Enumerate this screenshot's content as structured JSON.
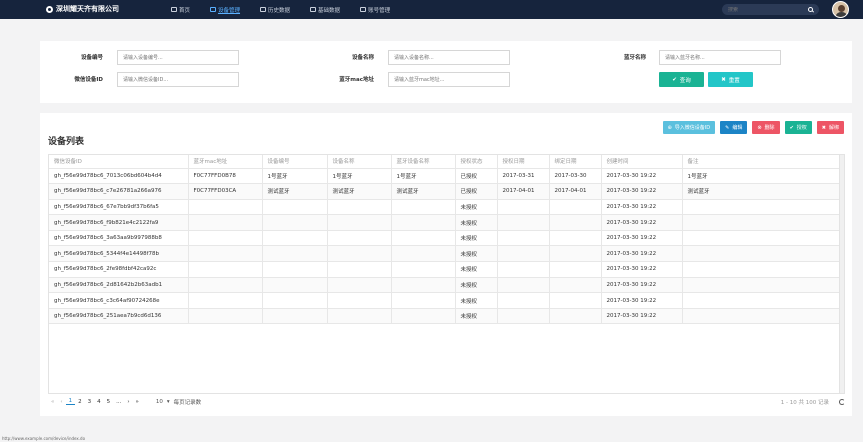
{
  "brand": "深圳耀天齐有限公司",
  "nav": [
    {
      "label": "首页",
      "icon": "home-icon"
    },
    {
      "label": "设备管理",
      "icon": "device-icon"
    },
    {
      "label": "历史数据",
      "icon": "history-icon"
    },
    {
      "label": "基础数据",
      "icon": "list-icon"
    },
    {
      "label": "账号管理",
      "icon": "account-icon"
    }
  ],
  "search": {
    "placeholder": "搜索"
  },
  "filter": {
    "device_no_label": "设备编号",
    "device_no_placeholder": "请输入设备编号...",
    "device_name_label": "设备名称",
    "device_name_placeholder": "请输入设备名称...",
    "bt_name_label": "蓝牙名称",
    "bt_name_placeholder": "请输入蓝牙名称...",
    "wx_device_label": "微信设备ID",
    "wx_device_placeholder": "请输入微信设备ID...",
    "bt_mac_label": "蓝牙mac地址",
    "bt_mac_placeholder": "请输入蓝牙mac地址...",
    "query_label": "查询",
    "reset_label": "重置"
  },
  "list": {
    "title": "设备列表",
    "tools": {
      "import_label": "导入微信设备ID",
      "edit_label": "编辑",
      "delete_label": "删除",
      "authorize_label": "授权",
      "unbind_label": "解绑"
    },
    "columns": [
      "微信设备ID",
      "蓝牙mac地址",
      "设备编号",
      "设备名称",
      "蓝牙设备名称",
      "授权状态",
      "授权日期",
      "绑定日期",
      "创建时间",
      "备注"
    ],
    "rows": [
      [
        "gh_f56e99d78bc6_7013c06bd604b4d4",
        "F0C77FFD0B78",
        "1号蓝牙",
        "1号蓝牙",
        "1号蓝牙",
        "已授权",
        "2017-03-31",
        "2017-03-30",
        "2017-03-30 19:22",
        "1号蓝牙"
      ],
      [
        "gh_f56e99d78bc6_c7e26781a266a976",
        "F0C77FFD03CA",
        "测试蓝牙",
        "测试蓝牙",
        "测试蓝牙",
        "已授权",
        "2017-04-01",
        "2017-04-01",
        "2017-03-30 19:22",
        "测试蓝牙"
      ],
      [
        "gh_f56e99d78bc6_67e7bb9df37b6fa5",
        "",
        "",
        "",
        "",
        "未授权",
        "",
        "",
        "2017-03-30 19:22",
        ""
      ],
      [
        "gh_f56e99d78bc6_f9b821e4c2122fa9",
        "",
        "",
        "",
        "",
        "未授权",
        "",
        "",
        "2017-03-30 19:22",
        ""
      ],
      [
        "gh_f56e99d78bc6_3a63aa9b997988b8",
        "",
        "",
        "",
        "",
        "未授权",
        "",
        "",
        "2017-03-30 19:22",
        ""
      ],
      [
        "gh_f56e99d78bc6_5344f4e14498f78b",
        "",
        "",
        "",
        "",
        "未授权",
        "",
        "",
        "2017-03-30 19:22",
        ""
      ],
      [
        "gh_f56e99d78bc6_2fe98fdbf42ca92c",
        "",
        "",
        "",
        "",
        "未授权",
        "",
        "",
        "2017-03-30 19:22",
        ""
      ],
      [
        "gh_f56e99d78bc6_2d81642b2b63adb1",
        "",
        "",
        "",
        "",
        "未授权",
        "",
        "",
        "2017-03-30 19:22",
        ""
      ],
      [
        "gh_f56e99d78bc6_c3c64af90724268e",
        "",
        "",
        "",
        "",
        "未授权",
        "",
        "",
        "2017-03-30 19:22",
        ""
      ],
      [
        "gh_f56e99d78bc6_251aea7b9cd6d136",
        "",
        "",
        "",
        "",
        "未授权",
        "",
        "",
        "2017-03-30 19:22",
        ""
      ]
    ],
    "pager": {
      "first": "«",
      "prev": "‹",
      "pages": [
        "1",
        "2",
        "3",
        "4",
        "5"
      ],
      "ellipsis": "...",
      "next": "›",
      "last": "»",
      "page_size": "10",
      "page_size_label": "每页记录数",
      "summary": "1 - 10 共 100 记录"
    }
  },
  "statusbar": "http://www.example.com/device/index.do"
}
